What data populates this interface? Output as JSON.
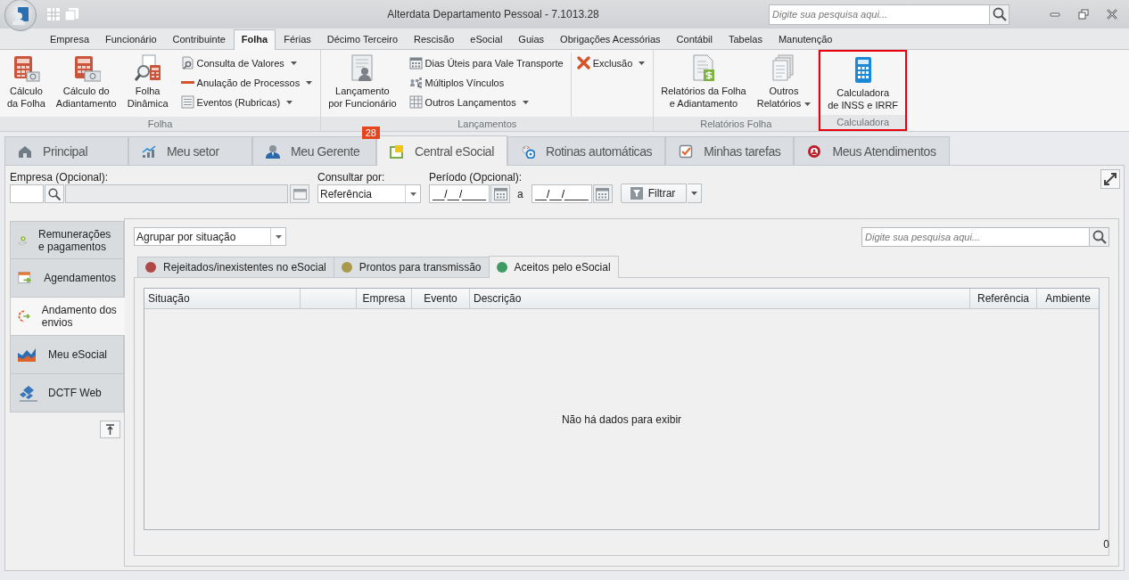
{
  "window": {
    "title": "Alterdata Departamento Pessoal - 7.1013.28",
    "search": {
      "placeholder": "Digite sua pesquisa aqui..."
    }
  },
  "menu_tabs": [
    {
      "label": "Empresa",
      "selected": false
    },
    {
      "label": "Funcionário",
      "selected": false
    },
    {
      "label": "Contribuinte",
      "selected": false
    },
    {
      "label": "Folha",
      "selected": true
    },
    {
      "label": "Férias",
      "selected": false
    },
    {
      "label": "Décimo Terceiro",
      "selected": false
    },
    {
      "label": "Rescisão",
      "selected": false
    },
    {
      "label": "eSocial",
      "selected": false
    },
    {
      "label": "Guias",
      "selected": false
    },
    {
      "label": "Obrigações Acessórias",
      "selected": false
    },
    {
      "label": "Contábil",
      "selected": false
    },
    {
      "label": "Tabelas",
      "selected": false
    },
    {
      "label": "Manutenção",
      "selected": false
    }
  ],
  "ribbon": {
    "groups": [
      {
        "label": "Folha",
        "highlighted": false,
        "items": [
          {
            "kind": "large",
            "label": "Cálculo\nda Folha",
            "dropdown": false
          },
          {
            "kind": "large",
            "label": "Cálculo do\nAdiantamento",
            "dropdown": false
          },
          {
            "kind": "large",
            "label": "Folha\nDinâmica",
            "dropdown": false
          },
          {
            "kind": "stack",
            "items": [
              {
                "label": "Consulta de Valores",
                "dropdown": true
              },
              {
                "label": "Anulação de Processos",
                "dropdown": true
              },
              {
                "label": "Eventos (Rubricas)",
                "dropdown": true
              }
            ]
          }
        ]
      },
      {
        "label": "Lançamentos",
        "highlighted": false,
        "items": [
          {
            "kind": "large",
            "label": "Lançamento\npor Funcionário",
            "dropdown": false
          },
          {
            "kind": "stack",
            "items": [
              {
                "label": "Dias Úteis para Vale Transporte",
                "dropdown": false
              },
              {
                "label": "Múltiplos Vínculos",
                "dropdown": false
              },
              {
                "label": "Outros Lançamentos",
                "dropdown": true
              }
            ]
          },
          {
            "kind": "stack",
            "items": [
              {
                "label": "Exclusão",
                "dropdown": true
              }
            ]
          }
        ]
      },
      {
        "label": "Relatórios Folha",
        "highlighted": false,
        "items": [
          {
            "kind": "large",
            "label": "Relatórios da Folha\ne Adiantamento",
            "dropdown": false
          },
          {
            "kind": "large",
            "label": "Outros\nRelatórios",
            "dropdown": true
          }
        ]
      },
      {
        "label": "Calculadora",
        "highlighted": true,
        "items": [
          {
            "kind": "large",
            "label": "Calculadora\nde INSS e IRRF",
            "dropdown": false
          }
        ]
      }
    ]
  },
  "workspace_tabs": [
    {
      "label": "Principal",
      "selected": false
    },
    {
      "label": "Meu setor",
      "selected": false
    },
    {
      "label": "Meu Gerente",
      "selected": false,
      "badge": "28"
    },
    {
      "label": "Central eSocial",
      "selected": true
    },
    {
      "label": "Rotinas automáticas",
      "selected": false
    },
    {
      "label": "Minhas tarefas",
      "selected": false
    },
    {
      "label": "Meus Atendimentos",
      "selected": false
    }
  ],
  "filters": {
    "empresa": {
      "label": "Empresa (Opcional):"
    },
    "consultar_por": {
      "label": "Consultar por:",
      "value": "Referência"
    },
    "periodo": {
      "label": "Período (Opcional):",
      "start": "__/__/____",
      "separator": "a",
      "end": "__/__/____"
    },
    "filter_button": "Filtrar"
  },
  "sidebar": {
    "items": [
      {
        "label": "Remunerações e pagamentos",
        "selected": false
      },
      {
        "label": "Agendamentos",
        "selected": false
      },
      {
        "label": "Andamento dos envios",
        "selected": true
      },
      {
        "label": "Meu eSocial",
        "selected": false
      },
      {
        "label": "DCTF Web",
        "selected": false
      }
    ]
  },
  "main": {
    "group_by": "Agrupar por situação",
    "search": {
      "placeholder": "Digite sua pesquisa aqui..."
    },
    "status_tabs": [
      {
        "label": "Rejeitados/inexistentes no eSocial",
        "color": "#b04848",
        "selected": false
      },
      {
        "label": "Prontos para transmissão",
        "color": "#a89a4a",
        "selected": false
      },
      {
        "label": "Aceitos pelo eSocial",
        "color": "#3d9b63",
        "selected": true
      }
    ],
    "table": {
      "columns": [
        {
          "kind": "text",
          "label": "Situação"
        },
        {
          "kind": "blank"
        },
        {
          "kind": "text",
          "label": "Empresa"
        },
        {
          "kind": "text",
          "label": "Evento"
        },
        {
          "kind": "text",
          "label": "Descrição"
        },
        {
          "kind": "text",
          "label": "Referência"
        },
        {
          "kind": "text",
          "label": "Ambiente"
        }
      ],
      "empty_message": "Não há dados para exibir"
    },
    "count": "0"
  }
}
